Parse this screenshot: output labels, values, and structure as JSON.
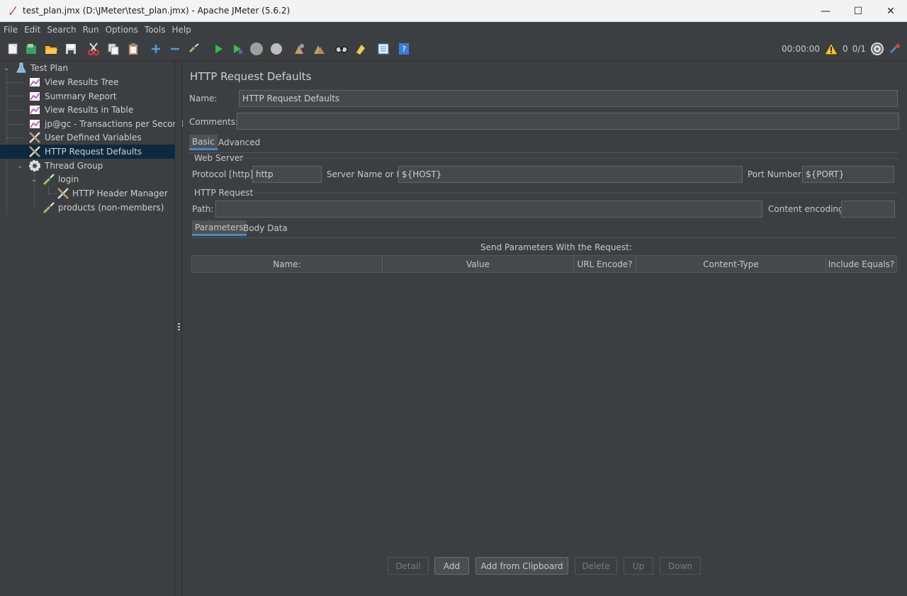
{
  "window": {
    "title": "test_plan.jmx (D:\\JMeter\\test_plan.jmx) - Apache JMeter (5.6.2)",
    "minimize": "—",
    "maximize": "☐",
    "close": "✕"
  },
  "menu": [
    "File",
    "Edit",
    "Search",
    "Run",
    "Options",
    "Tools",
    "Help"
  ],
  "toolbar": {
    "timer": "00:00:00",
    "warnings": "0",
    "threads": "0/1"
  },
  "tree": {
    "items": [
      {
        "label": "Test Plan",
        "icon": "test-plan-icon"
      },
      {
        "label": "View Results Tree",
        "icon": "listener-icon"
      },
      {
        "label": "Summary Report",
        "icon": "listener-icon"
      },
      {
        "label": "View Results in Table",
        "icon": "listener-icon"
      },
      {
        "label": "jp@gc - Transactions per Second",
        "icon": "listener-icon"
      },
      {
        "label": "User Defined Variables",
        "icon": "config-icon"
      },
      {
        "label": "HTTP Request Defaults",
        "icon": "config-icon"
      },
      {
        "label": "Thread Group",
        "icon": "thread-group-icon"
      },
      {
        "label": "login",
        "icon": "sampler-icon"
      },
      {
        "label": "HTTP Header Manager",
        "icon": "config-icon"
      },
      {
        "label": "products (non-members)",
        "icon": "sampler-icon"
      }
    ]
  },
  "panel": {
    "title": "HTTP Request Defaults",
    "name_label": "Name:",
    "name_value": "HTTP Request Defaults",
    "comments_label": "Comments:",
    "comments_value": "",
    "tabs": [
      "Basic",
      "Advanced"
    ],
    "web_server_group": "Web Server",
    "protocol_label": "Protocol [http]:",
    "protocol_value": "http",
    "server_label": "Server Name or IP:",
    "server_value": "${HOST}",
    "port_label": "Port Number:",
    "port_value": "${PORT}",
    "http_request_group": "HTTP Request",
    "path_label": "Path:",
    "path_value": "",
    "encoding_label": "Content encoding:",
    "encoding_value": "",
    "sub_tabs": [
      "Parameters",
      "Body Data"
    ],
    "params_title": "Send Parameters With the Request:",
    "columns": [
      "Name:",
      "Value",
      "URL Encode?",
      "Content-Type",
      "Include Equals?"
    ],
    "buttons": {
      "detail": "Detail",
      "add": "Add",
      "add_clipboard": "Add from Clipboard",
      "delete": "Delete",
      "up": "Up",
      "down": "Down"
    }
  },
  "colors": {
    "background": "#3c3f41",
    "selection": "#0d293e",
    "accent": "#4a88c7"
  }
}
